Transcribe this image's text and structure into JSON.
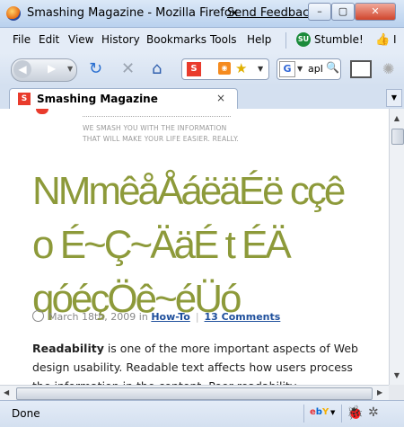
{
  "window": {
    "title": "Smashing Magazine - Mozilla Firefox",
    "feedback_link": "Send Feedback",
    "minimize": "–",
    "maximize": "▢",
    "close": "✕"
  },
  "menu": {
    "items": [
      "File",
      "Edit",
      "View",
      "History",
      "Bookmarks",
      "Tools",
      "Help"
    ],
    "stumble_label": "Stumble!",
    "stumble_icon_text": "SU",
    "thumb_label": "I"
  },
  "toolbar": {
    "search_value": "apl",
    "site_icon_letter": "S",
    "google_letter": "G"
  },
  "tab": {
    "title": "Smashing Magazine",
    "close": "×"
  },
  "page": {
    "tagline": "WE SMASH YOU WITH THE INFORMATION THAT WILL MAKE YOUR LIFE EASIER. REALLY.",
    "headline_lines": [
      "NMmêåÅáëäÉë cçê",
      "o É~Ç~ÄäÉ t ÉÄ",
      "qóéçÖê~éÜó"
    ],
    "date": "March 18th, 2009 in",
    "category": "How-To",
    "comments": "13 Comments",
    "para_bold": "Readability",
    "para_text": " is one of the more important aspects of Web design usability. Readable text affects how users process the information in the content. Poor readability"
  },
  "status": {
    "text": "Done",
    "ebay": "ebY"
  },
  "colors": {
    "headline": "#8d9a3a",
    "link": "#1e4f9c",
    "brand_red": "#e93b2c"
  }
}
